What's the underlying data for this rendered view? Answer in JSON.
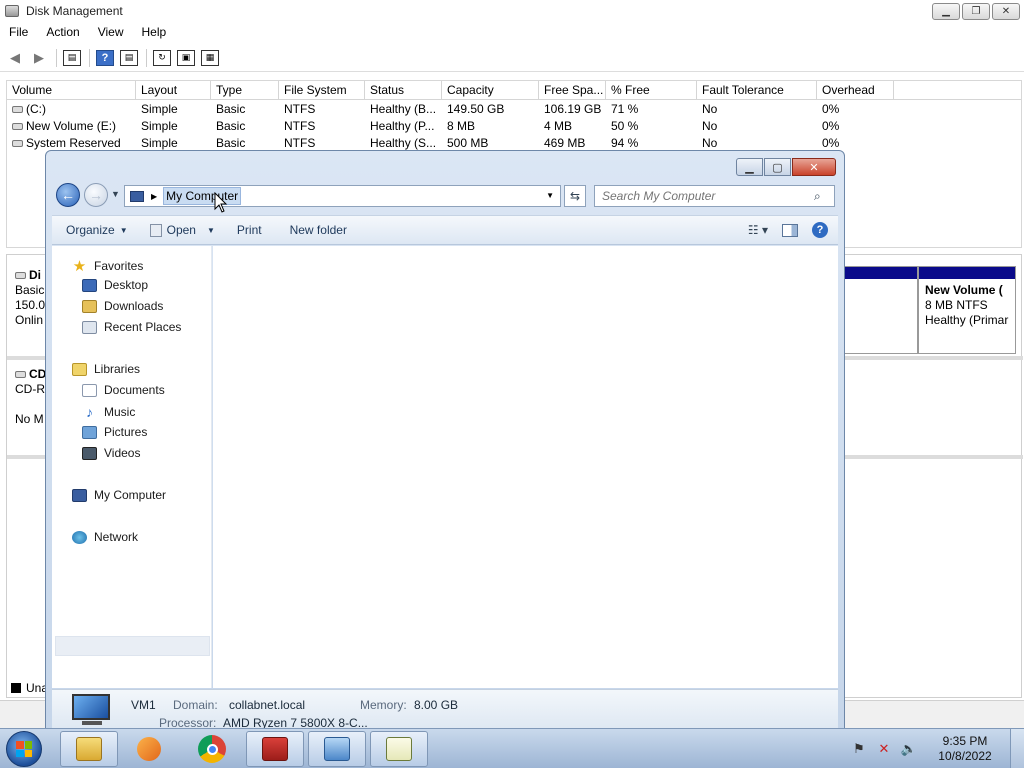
{
  "disk_mgmt": {
    "title": "Disk Management",
    "menu": [
      "File",
      "Action",
      "View",
      "Help"
    ],
    "columns": [
      "Volume",
      "Layout",
      "Type",
      "File System",
      "Status",
      "Capacity",
      "Free Spa...",
      "% Free",
      "Fault Tolerance",
      "Overhead"
    ],
    "rows": [
      [
        "(C:)",
        "Simple",
        "Basic",
        "NTFS",
        "Healthy (B...",
        "149.50 GB",
        "106.19 GB",
        "71 %",
        "No",
        "0%"
      ],
      [
        "New Volume (E:)",
        "Simple",
        "Basic",
        "NTFS",
        "Healthy (P...",
        "8 MB",
        "4 MB",
        "50 %",
        "No",
        "0%"
      ],
      [
        "System Reserved",
        "Simple",
        "Basic",
        "NTFS",
        "Healthy (S...",
        "500 MB",
        "469 MB",
        "94 %",
        "No",
        "0%"
      ]
    ],
    "disk0": {
      "name": "Di",
      "type": "Basic",
      "size": "150.0",
      "state": "Onlin"
    },
    "cdrom": {
      "name": "CD",
      "type": "CD-R",
      "media": "No M"
    },
    "partition_e": {
      "name": "New Volume  (",
      "fs": "8 MB NTFS",
      "status": "Healthy (Primar"
    },
    "legend_unallocated": "Una"
  },
  "explorer": {
    "address_crumb": "My Computer",
    "search_placeholder": "Search My Computer",
    "commands": {
      "organize": "Organize",
      "open": "Open",
      "print": "Print",
      "new_folder": "New folder"
    },
    "nav": {
      "favorites": "Favorites",
      "desktop": "Desktop",
      "downloads": "Downloads",
      "recent": "Recent Places",
      "libraries": "Libraries",
      "documents": "Documents",
      "music": "Music",
      "pictures": "Pictures",
      "videos": "Videos",
      "my_computer": "My Computer",
      "network": "Network"
    },
    "details": {
      "name": "VM1",
      "domain_label": "Domain:",
      "domain": "collabnet.local",
      "memory_label": "Memory:",
      "memory": "8.00 GB",
      "processor_label": "Processor:",
      "processor": "AMD Ryzen 7 5800X 8-C..."
    }
  },
  "taskbar": {
    "time": "9:35 PM",
    "date": "10/8/2022",
    "apps": [
      "file-explorer",
      "media-player",
      "chrome",
      "toolbox",
      "control-panel",
      "notepad-chart"
    ]
  }
}
